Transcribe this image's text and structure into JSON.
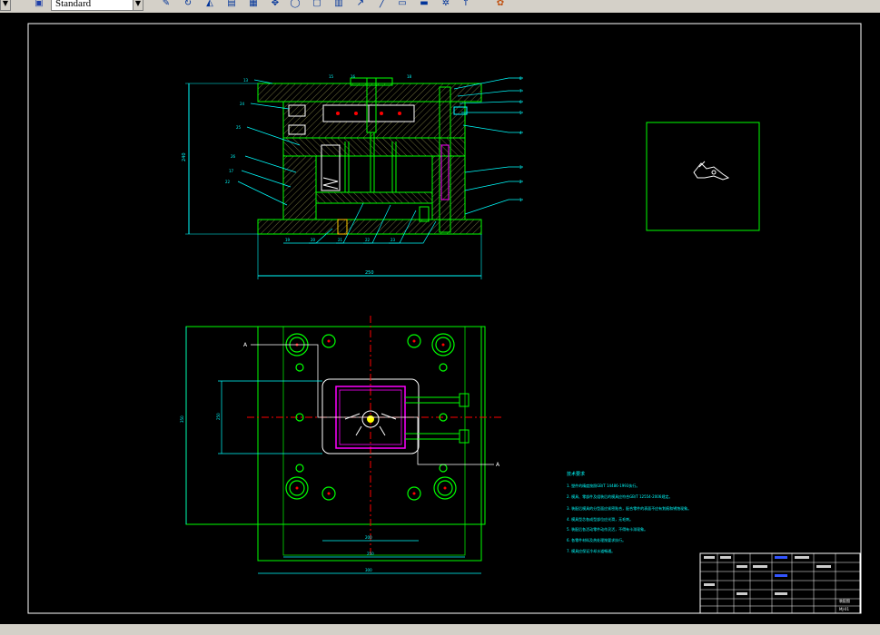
{
  "toolbar": {
    "text_style_value": "Standard",
    "icons": [
      "layer-icon",
      "text-style-icon",
      "edit-pen-icon",
      "draw-icon",
      "triangle-icon",
      "pan-icon",
      "orbit-icon",
      "properties-icon",
      "zoom-icon",
      "arrow-icon",
      "window-icon",
      "table-icon",
      "gear-icon",
      "pointer-icon",
      "paint-icon"
    ]
  },
  "drawing": {
    "colors": {
      "frame": "#ffffff",
      "outline": "#00ff00",
      "dim": "#00ffff",
      "center": "#ff0000",
      "ejector": "#ff00ff",
      "hatch": "#7a7a3a"
    },
    "section_callouts_top": [
      "13",
      "15",
      "16",
      "18",
      "8",
      "7",
      "6",
      "5",
      "4",
      "3",
      "2",
      "1"
    ],
    "section_callouts_left": [
      "23",
      "24",
      "25",
      "26",
      "17",
      "22"
    ],
    "section_callouts_bottom": [
      "19",
      "20",
      "21",
      "22",
      "23"
    ],
    "dim_height": "240",
    "dim_width": "250",
    "plan_dim_left": "350",
    "plan_dim_left_inner": "250",
    "plan_dim_bottom_inner": "200",
    "plan_dim_bottom_mid": "250",
    "plan_dim_bottom_outer": "300",
    "section_marker_a_left": "A",
    "section_marker_a_right": "A",
    "tech_title": "技术要求",
    "tech_notes": [
      "1. 塑件的精度按照GB/T 14486-1993执行。",
      "2. 模具、零部件及组装后的模具应符合GB/T 12554-2006规定。",
      "3. 装配后模具的分型面应紧密贴合，配合零件的表面不应有划痕和锈蚀现象。",
      "4. 模具型芯各成型部位应光滑，无毛刺。",
      "5. 装配后各活动零件动作灵活，不得有卡滞现象。",
      "6. 各零件材料及热处理按要求执行。",
      "7. 模具应保证冷却水道畅通。"
    ],
    "title_block": {
      "drawing_name": "装配图",
      "drawing_no": "MJ-01"
    }
  }
}
